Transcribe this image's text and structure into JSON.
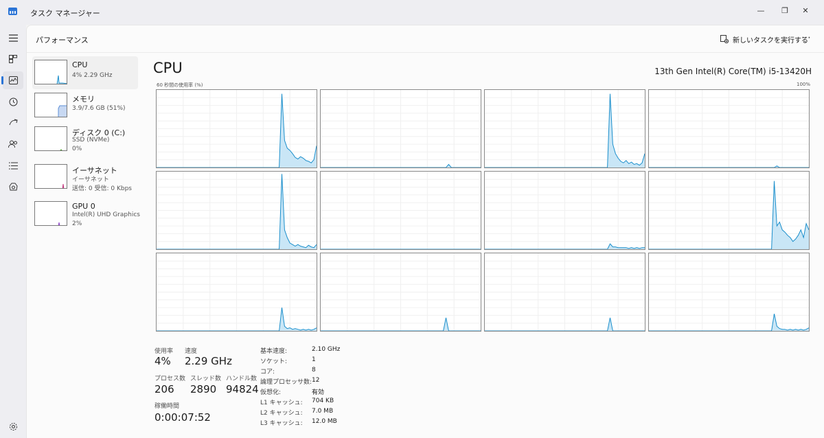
{
  "window": {
    "title": "タスク マネージャー",
    "minimize_icon": "—",
    "maximize_icon": "❐",
    "close_icon": "✕"
  },
  "command_bar": {
    "page_title": "パフォーマンス",
    "run_task_label": "新しいタスクを実行する",
    "more_icon": "⋯"
  },
  "rail": {
    "items": [
      "menu-icon",
      "processes-icon",
      "performance-icon",
      "app-history-icon",
      "startup-icon",
      "users-icon",
      "details-icon",
      "services-icon"
    ],
    "settings": "gear-icon"
  },
  "devices": [
    {
      "name": "CPU",
      "sub1": "4% 2.29 GHz",
      "sub2": "",
      "color": "#1a8ecb"
    },
    {
      "name": "メモリ",
      "sub1": "3.9/7.6 GB (51%)",
      "sub2": "",
      "color": "#5e8fd6"
    },
    {
      "name": "ディスク 0 (C:)",
      "sub1": "SSD (NVMe)",
      "sub2": "0%",
      "color": "#4c9a2a"
    },
    {
      "name": "イーサネット",
      "sub1": "イーサネット",
      "sub2": "送信: 0 受信: 0 Kbps",
      "color": "#c0327a"
    },
    {
      "name": "GPU 0",
      "sub1": "Intel(R) UHD Graphics",
      "sub2": "2%",
      "color": "#8a3fc7"
    }
  ],
  "cpu": {
    "title": "CPU",
    "model": "13th Gen Intel(R) Core(TM) i5-13420H",
    "graph_label": "60 秒間の使用率 (%)",
    "graph_max": "100%",
    "line_color": "#1a8ecb",
    "fill_color": "#c9e6f6"
  },
  "chart_data": {
    "type": "area",
    "title": "60 秒間の使用率 (%)",
    "ylim": [
      0,
      100
    ],
    "xlim": [
      0,
      60
    ],
    "grid": true,
    "series": [
      {
        "values": [
          0,
          0,
          0,
          0,
          0,
          0,
          0,
          0,
          0,
          0,
          0,
          0,
          0,
          0,
          0,
          0,
          0,
          0,
          0,
          0,
          0,
          0,
          0,
          0,
          0,
          0,
          0,
          0,
          0,
          0,
          0,
          0,
          0,
          0,
          0,
          0,
          0,
          0,
          0,
          0,
          0,
          0,
          0,
          0,
          0,
          0,
          0,
          95,
          35,
          25,
          22,
          18,
          13,
          11,
          14,
          12,
          9,
          8,
          6,
          10,
          28
        ]
      },
      {
        "values": [
          0,
          0,
          0,
          0,
          0,
          0,
          0,
          0,
          0,
          0,
          0,
          0,
          0,
          0,
          0,
          0,
          0,
          0,
          0,
          0,
          0,
          0,
          0,
          0,
          0,
          0,
          0,
          0,
          0,
          0,
          0,
          0,
          0,
          0,
          0,
          0,
          0,
          0,
          0,
          0,
          0,
          0,
          0,
          0,
          0,
          0,
          0,
          0,
          4,
          0,
          0,
          0,
          0,
          0,
          0,
          0,
          0,
          0,
          0,
          0,
          0
        ]
      },
      {
        "values": [
          0,
          0,
          0,
          0,
          0,
          0,
          0,
          0,
          0,
          0,
          0,
          0,
          0,
          0,
          0,
          0,
          0,
          0,
          0,
          0,
          0,
          0,
          0,
          0,
          0,
          0,
          0,
          0,
          0,
          0,
          0,
          0,
          0,
          0,
          0,
          0,
          0,
          0,
          0,
          0,
          0,
          0,
          0,
          0,
          0,
          0,
          0,
          95,
          30,
          18,
          12,
          8,
          6,
          9,
          5,
          7,
          4,
          5,
          3,
          6,
          18
        ]
      },
      {
        "values": [
          0,
          0,
          0,
          0,
          0,
          0,
          0,
          0,
          0,
          0,
          0,
          0,
          0,
          0,
          0,
          0,
          0,
          0,
          0,
          0,
          0,
          0,
          0,
          0,
          0,
          0,
          0,
          0,
          0,
          0,
          0,
          0,
          0,
          0,
          0,
          0,
          0,
          0,
          0,
          0,
          0,
          0,
          0,
          0,
          0,
          0,
          0,
          0,
          2,
          0,
          0,
          0,
          0,
          0,
          0,
          0,
          0,
          0,
          0,
          0,
          0
        ]
      },
      {
        "values": [
          0,
          0,
          0,
          0,
          0,
          0,
          0,
          0,
          0,
          0,
          0,
          0,
          0,
          0,
          0,
          0,
          0,
          0,
          0,
          0,
          0,
          0,
          0,
          0,
          0,
          0,
          0,
          0,
          0,
          0,
          0,
          0,
          0,
          0,
          0,
          0,
          0,
          0,
          0,
          0,
          0,
          0,
          0,
          0,
          0,
          0,
          0,
          97,
          25,
          15,
          8,
          6,
          4,
          6,
          4,
          3,
          2,
          5,
          3,
          2,
          6
        ]
      },
      {
        "values": [
          0,
          0,
          0,
          0,
          0,
          0,
          0,
          0,
          0,
          0,
          0,
          0,
          0,
          0,
          0,
          0,
          0,
          0,
          0,
          0,
          0,
          0,
          0,
          0,
          0,
          0,
          0,
          0,
          0,
          0,
          0,
          0,
          0,
          0,
          0,
          0,
          0,
          0,
          0,
          0,
          0,
          0,
          0,
          0,
          0,
          0,
          0,
          0,
          0,
          0,
          0,
          0,
          0,
          0,
          0,
          0,
          0,
          0,
          0,
          0,
          0
        ]
      },
      {
        "values": [
          0,
          0,
          0,
          0,
          0,
          0,
          0,
          0,
          0,
          0,
          0,
          0,
          0,
          0,
          0,
          0,
          0,
          0,
          0,
          0,
          0,
          0,
          0,
          0,
          0,
          0,
          0,
          0,
          0,
          0,
          0,
          0,
          0,
          0,
          0,
          0,
          0,
          0,
          0,
          0,
          0,
          0,
          0,
          0,
          0,
          0,
          0,
          7,
          3,
          3,
          2,
          2,
          2,
          2,
          1,
          2,
          1,
          2,
          1,
          2,
          2
        ]
      },
      {
        "values": [
          0,
          0,
          0,
          0,
          0,
          0,
          0,
          0,
          0,
          0,
          0,
          0,
          0,
          0,
          0,
          0,
          0,
          0,
          0,
          0,
          0,
          0,
          0,
          0,
          0,
          0,
          0,
          0,
          0,
          0,
          0,
          0,
          0,
          0,
          0,
          0,
          0,
          0,
          0,
          0,
          0,
          0,
          0,
          0,
          0,
          0,
          0,
          88,
          30,
          35,
          25,
          22,
          18,
          15,
          10,
          13,
          18,
          25,
          15,
          33,
          25
        ]
      },
      {
        "values": [
          0,
          0,
          0,
          0,
          0,
          0,
          0,
          0,
          0,
          0,
          0,
          0,
          0,
          0,
          0,
          0,
          0,
          0,
          0,
          0,
          0,
          0,
          0,
          0,
          0,
          0,
          0,
          0,
          0,
          0,
          0,
          0,
          0,
          0,
          0,
          0,
          0,
          0,
          0,
          0,
          0,
          0,
          0,
          0,
          0,
          0,
          0,
          30,
          6,
          3,
          4,
          2,
          3,
          2,
          1,
          2,
          1,
          2,
          1,
          2,
          4
        ]
      },
      {
        "values": [
          0,
          0,
          0,
          0,
          0,
          0,
          0,
          0,
          0,
          0,
          0,
          0,
          0,
          0,
          0,
          0,
          0,
          0,
          0,
          0,
          0,
          0,
          0,
          0,
          0,
          0,
          0,
          0,
          0,
          0,
          0,
          0,
          0,
          0,
          0,
          0,
          0,
          0,
          0,
          0,
          0,
          0,
          0,
          0,
          0,
          0,
          0,
          17,
          0,
          0,
          0,
          0,
          0,
          0,
          0,
          0,
          0,
          0,
          0,
          0,
          0
        ]
      },
      {
        "values": [
          0,
          0,
          0,
          0,
          0,
          0,
          0,
          0,
          0,
          0,
          0,
          0,
          0,
          0,
          0,
          0,
          0,
          0,
          0,
          0,
          0,
          0,
          0,
          0,
          0,
          0,
          0,
          0,
          0,
          0,
          0,
          0,
          0,
          0,
          0,
          0,
          0,
          0,
          0,
          0,
          0,
          0,
          0,
          0,
          0,
          0,
          0,
          17,
          0,
          0,
          0,
          0,
          0,
          0,
          0,
          0,
          0,
          0,
          0,
          0,
          0
        ]
      },
      {
        "values": [
          0,
          0,
          0,
          0,
          0,
          0,
          0,
          0,
          0,
          0,
          0,
          0,
          0,
          0,
          0,
          0,
          0,
          0,
          0,
          0,
          0,
          0,
          0,
          0,
          0,
          0,
          0,
          0,
          0,
          0,
          0,
          0,
          0,
          0,
          0,
          0,
          0,
          0,
          0,
          0,
          0,
          0,
          0,
          0,
          0,
          0,
          0,
          22,
          6,
          3,
          2,
          2,
          1,
          2,
          1,
          2,
          1,
          2,
          1,
          2,
          4
        ]
      }
    ]
  },
  "stats": {
    "usage_label": "使用率",
    "usage_value": "4%",
    "speed_label": "速度",
    "speed_value": "2.29 GHz",
    "processes_label": "プロセス数",
    "processes_value": "206",
    "threads_label": "スレッド数",
    "threads_value": "2890",
    "handles_label": "ハンドル数",
    "handles_value": "94824",
    "uptime_label": "稼働時間",
    "uptime_value": "0:00:07:52"
  },
  "specs": [
    {
      "label": "基本速度:",
      "value": "2.10 GHz"
    },
    {
      "label": "ソケット:",
      "value": "1"
    },
    {
      "label": "コア:",
      "value": "8"
    },
    {
      "label": "論理プロセッサ数:",
      "value": "12"
    },
    {
      "label": "仮想化:",
      "value": "有効"
    },
    {
      "label": "L1 キャッシュ:",
      "value": "704 KB"
    },
    {
      "label": "L2 キャッシュ:",
      "value": "7.0 MB"
    },
    {
      "label": "L3 キャッシュ:",
      "value": "12.0 MB"
    }
  ]
}
